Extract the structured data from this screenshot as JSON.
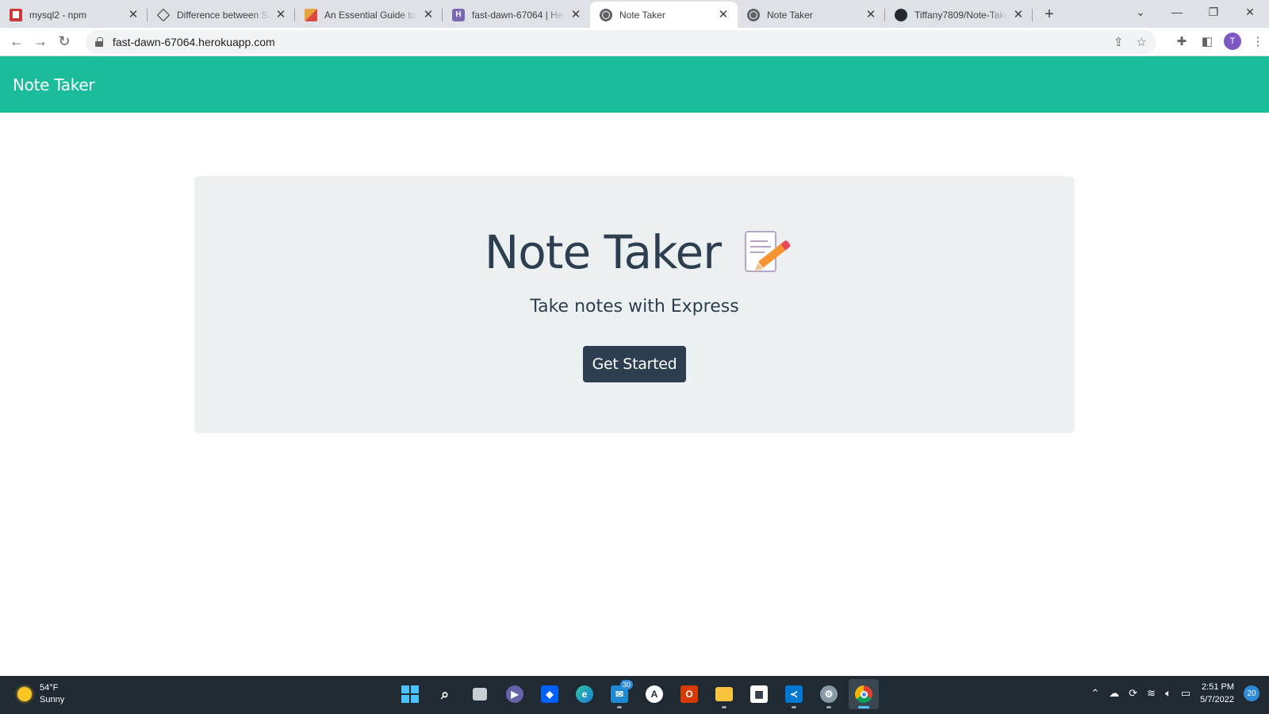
{
  "browser": {
    "tabs": [
      {
        "title": "mysql2 - npm",
        "favicon": "npm-icon"
      },
      {
        "title": "Difference between Sch",
        "favicon": "diamond-icon"
      },
      {
        "title": "An Essential Guide to M",
        "favicon": "m-logo-icon"
      },
      {
        "title": "fast-dawn-67064 | Hero",
        "favicon": "heroku-icon"
      },
      {
        "title": "Note Taker",
        "favicon": "globe-icon",
        "active": true
      },
      {
        "title": "Note Taker",
        "favicon": "globe-icon"
      },
      {
        "title": "Tiffany7809/Note-Take",
        "favicon": "github-icon"
      }
    ],
    "url": "fast-dawn-67064.herokuapp.com",
    "profile_initial": "T"
  },
  "page": {
    "brand": "Note Taker",
    "jumbotron": {
      "title": "Note Taker",
      "subtitle": "Take notes with Express",
      "button": "Get Started"
    },
    "colors": {
      "navbar": "#1abc9c",
      "jumbotron": "#ecf0f1",
      "button": "#2c3e50",
      "text": "#2c3e50"
    }
  },
  "taskbar": {
    "weather": {
      "temp": "54°F",
      "condition": "Sunny"
    },
    "mail_badge": "30",
    "time": "2:51 PM",
    "date": "5/7/2022",
    "notifications": "20"
  }
}
